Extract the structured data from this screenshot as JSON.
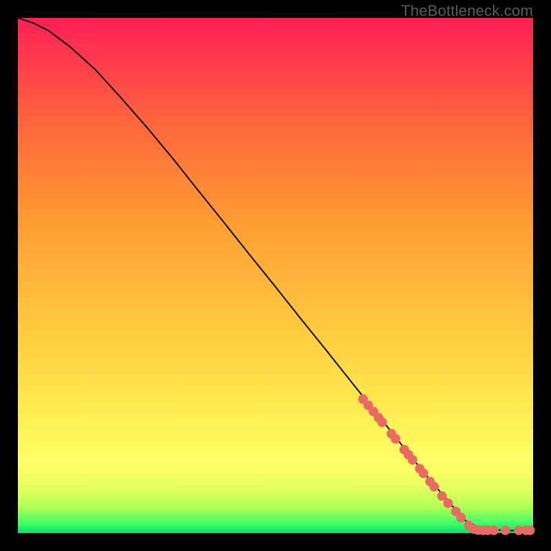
{
  "watermark": "TheBottleneck.com",
  "colors": {
    "frame": "#000000",
    "curve": "#000000",
    "marker_fill": "#e86b62",
    "marker_stroke": "#b24a45"
  },
  "chart_data": {
    "type": "line",
    "title": "",
    "xlabel": "",
    "ylabel": "",
    "xlim": [
      0,
      100
    ],
    "ylim": [
      0,
      100
    ],
    "grid": false,
    "series": [
      {
        "name": "curve",
        "x": [
          0,
          3,
          6,
          10,
          15,
          20,
          25,
          30,
          35,
          40,
          45,
          50,
          55,
          60,
          65,
          70,
          75,
          80,
          85,
          87,
          90,
          93,
          96,
          100
        ],
        "y": [
          100,
          99,
          97.5,
          94.5,
          90,
          84.5,
          78.8,
          72.8,
          66.5,
          60.3,
          54,
          47.8,
          41.5,
          35.3,
          29,
          22.8,
          16.5,
          10.3,
          4.5,
          2.3,
          1.0,
          0.6,
          0.5,
          0.5
        ]
      }
    ],
    "markers": [
      {
        "x": 67,
        "y": 26.0
      },
      {
        "x": 68,
        "y": 24.8
      },
      {
        "x": 69,
        "y": 23.6
      },
      {
        "x": 70,
        "y": 22.4
      },
      {
        "x": 70.7,
        "y": 21.5
      },
      {
        "x": 72.5,
        "y": 19.3
      },
      {
        "x": 73.3,
        "y": 18.3
      },
      {
        "x": 75,
        "y": 16.2
      },
      {
        "x": 75.8,
        "y": 15.2
      },
      {
        "x": 76.6,
        "y": 14.2
      },
      {
        "x": 78,
        "y": 12.5
      },
      {
        "x": 78.7,
        "y": 11.6
      },
      {
        "x": 80,
        "y": 10.0
      },
      {
        "x": 80.8,
        "y": 9.0
      },
      {
        "x": 82.3,
        "y": 7.2
      },
      {
        "x": 83.5,
        "y": 5.8
      },
      {
        "x": 85,
        "y": 4.2
      },
      {
        "x": 86,
        "y": 3.0
      },
      {
        "x": 87.5,
        "y": 1.5
      },
      {
        "x": 88.5,
        "y": 0.8
      },
      {
        "x": 89.3,
        "y": 0.6
      },
      {
        "x": 90.3,
        "y": 0.55
      },
      {
        "x": 91.2,
        "y": 0.55
      },
      {
        "x": 92.4,
        "y": 0.55
      },
      {
        "x": 94.6,
        "y": 0.55
      },
      {
        "x": 97.2,
        "y": 0.55
      },
      {
        "x": 98.6,
        "y": 0.55
      },
      {
        "x": 99.4,
        "y": 0.55
      }
    ],
    "marker_radius_px": 7
  }
}
